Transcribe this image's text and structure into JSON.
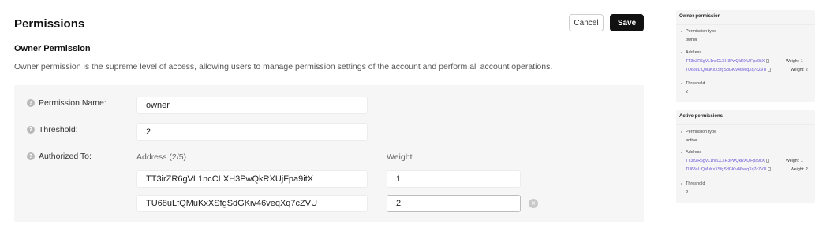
{
  "header": {
    "title": "Permissions",
    "cancel_label": "Cancel",
    "save_label": "Save"
  },
  "owner_section": {
    "title": "Owner Permission",
    "description": "Owner permission is the supreme level of access, allowing users to manage permission settings of the account and perform all account operations."
  },
  "form": {
    "help_glyph": "?",
    "name_label": "Permission Name:",
    "name_value": "owner",
    "threshold_label": "Threshold:",
    "threshold_value": "2",
    "authorized_label": "Authorized To:",
    "address_header": "Address (2/5)",
    "weight_header": "Weight",
    "keys": [
      {
        "address": "TT3irZR6gVL1ncCLXH3PwQkRXUjFpa9itX",
        "weight": "1"
      },
      {
        "address": "TU68uLfQMuKxXSfgSdGKiv46veqXq7cZVU",
        "weight": "2"
      }
    ],
    "remove_glyph": "×"
  },
  "summary": {
    "owner_card": {
      "title": "Owner permission",
      "type_label": "Permission type",
      "type_value": "owner",
      "address_label": "Address",
      "keys": [
        {
          "address": "TT3irZR6gVL1ncCLXH3PwQkRXUjFpa9itX",
          "weight": "Weight: 1"
        },
        {
          "address": "TU68uLfQMuKxXSfgSdGKiv46veqXq7cZVU",
          "weight": "Weight: 2"
        }
      ],
      "threshold_label": "Threshold",
      "threshold_value": "2"
    },
    "active_card": {
      "title": "Active permissions",
      "type_label": "Permission type",
      "type_value": "active",
      "address_label": "Address",
      "keys": [
        {
          "address": "TT3irZR6gVL1ncCLXH3PwQkRXUjFpa9itX",
          "weight": "Weight: 1"
        },
        {
          "address": "TU68uLfQMuKxXSfgSdGKiv46veqXq7cZVU",
          "weight": "Weight: 2"
        }
      ],
      "threshold_label": "Threshold",
      "threshold_value": "2"
    }
  },
  "colors": {
    "accent_link": "#6a4fd6",
    "primary_button": "#111111",
    "panel_bg": "#f6f6f6"
  }
}
